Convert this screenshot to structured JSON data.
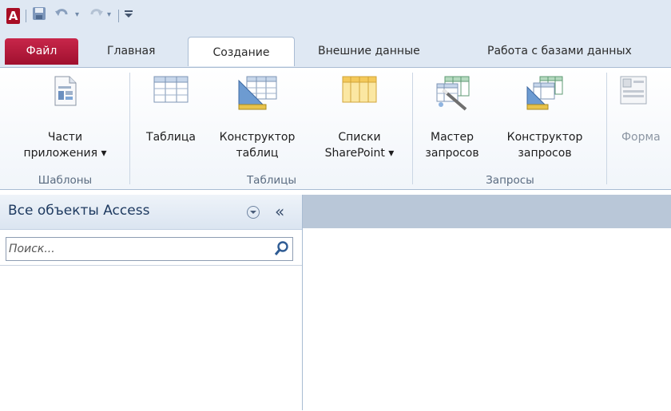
{
  "app": {
    "logo_letter": "A"
  },
  "quick_access": {
    "items": [
      "save-icon",
      "undo-icon",
      "dropdown-arrow-icon",
      "redo-icon",
      "dropdown-arrow-icon",
      "customize-toolbar-icon"
    ]
  },
  "tabs": {
    "file": "Файл",
    "home": "Главная",
    "create": "Создание",
    "external": "Внешние данные",
    "database_tools": "Работа с базами данных"
  },
  "ribbon": {
    "templates": {
      "label": "Шаблоны",
      "app_parts": {
        "line1": "Части",
        "line2": "приложения ▾"
      }
    },
    "tables": {
      "label": "Таблицы",
      "table": {
        "line1": "Таблица",
        "line2": ""
      },
      "table_design": {
        "line1": "Конструктор",
        "line2": "таблиц"
      },
      "sharepoint_lists": {
        "line1": "Списки",
        "line2": "SharePoint ▾"
      }
    },
    "queries": {
      "label": "Запросы",
      "query_wizard": {
        "line1": "Мастер",
        "line2": "запросов"
      },
      "query_design": {
        "line1": "Конструктор",
        "line2": "запросов"
      }
    },
    "forms": {
      "form": {
        "line1": "Форма",
        "line2": ""
      }
    }
  },
  "nav_pane": {
    "title": "Все объекты Access",
    "collapse_glyph": "«",
    "search_placeholder": "Поиск..."
  },
  "colors": {
    "file_tab": "#b8183c",
    "ribbon_bg": "#ffffff",
    "chrome_bg": "#dfe8f3",
    "workspace_strip": "#b9c7d8"
  }
}
